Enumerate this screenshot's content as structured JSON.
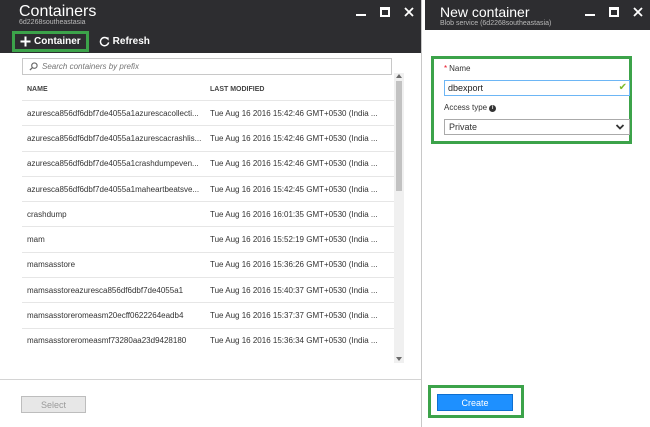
{
  "containers_blade": {
    "title": "Containers",
    "subtitle": "6d2268southeastasia",
    "toolbar": {
      "container_label": "Container",
      "refresh_label": "Refresh"
    },
    "search": {
      "placeholder": "Search containers by prefix"
    },
    "columns": {
      "name": "NAME",
      "last_modified": "LAST MODIFIED"
    },
    "rows": [
      {
        "name": "azuresca856df6dbf7de4055a1azurescacollecti...",
        "modified": "Tue Aug 16 2016 15:42:46 GMT+0530 (India ..."
      },
      {
        "name": "azuresca856df6dbf7de4055a1azurescacrashlis...",
        "modified": "Tue Aug 16 2016 15:42:46 GMT+0530 (India ..."
      },
      {
        "name": "azuresca856df6dbf7de4055a1crashdumpeven...",
        "modified": "Tue Aug 16 2016 15:42:46 GMT+0530 (India ..."
      },
      {
        "name": "azuresca856df6dbf7de4055a1maheartbeatsve...",
        "modified": "Tue Aug 16 2016 15:42:45 GMT+0530 (India ..."
      },
      {
        "name": "crashdump",
        "modified": "Tue Aug 16 2016 16:01:35 GMT+0530 (India ..."
      },
      {
        "name": "mam",
        "modified": "Tue Aug 16 2016 15:52:19 GMT+0530 (India ..."
      },
      {
        "name": "mamsasstore",
        "modified": "Tue Aug 16 2016 15:36:26 GMT+0530 (India ..."
      },
      {
        "name": "mamsasstoreazuresca856df6dbf7de4055a1",
        "modified": "Tue Aug 16 2016 15:40:37 GMT+0530 (India ..."
      },
      {
        "name": "mamsasstoreromeasm20ecff0622264eadb4",
        "modified": "Tue Aug 16 2016 15:37:37 GMT+0530 (India ..."
      },
      {
        "name": "mamsasstoreromeasmf73280aa23d9428180",
        "modified": "Tue Aug 16 2016 15:36:34 GMT+0530 (India ..."
      }
    ],
    "select_label": "Select"
  },
  "new_container_blade": {
    "title": "New container",
    "subtitle": "Blob service (6d2268southeastasia)",
    "name_label": "Name",
    "name_value": "dbexport",
    "access_type_label": "Access type",
    "access_type_value": "Private",
    "create_label": "Create"
  },
  "colors": {
    "header_bg": "#2d2d30",
    "highlight": "#3ca34a",
    "primary_button": "#1e90ff"
  }
}
